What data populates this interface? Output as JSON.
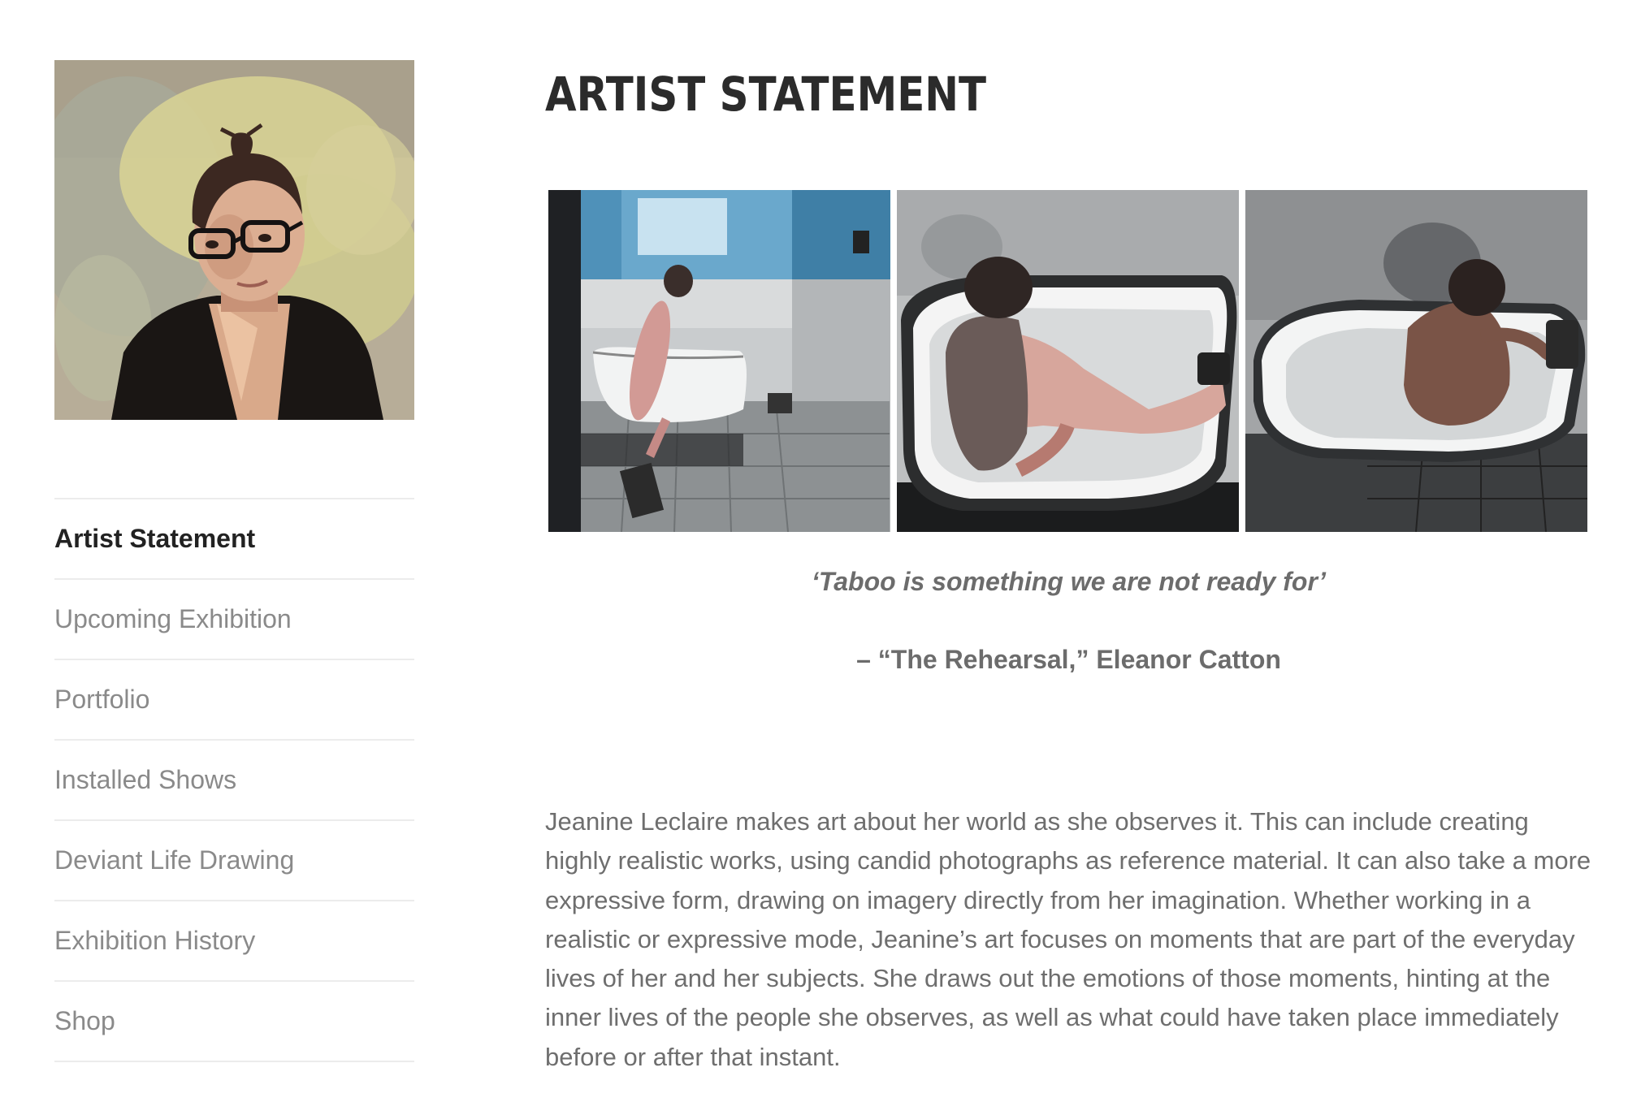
{
  "sidebar": {
    "portrait_alt": "Portrait of the artist",
    "nav": [
      {
        "label": "Artist Statement",
        "active": true
      },
      {
        "label": "Upcoming Exhibition",
        "active": false
      },
      {
        "label": "Portfolio",
        "active": false
      },
      {
        "label": "Installed Shows",
        "active": false
      },
      {
        "label": "Deviant Life Drawing",
        "active": false
      },
      {
        "label": "Exhibition History",
        "active": false
      },
      {
        "label": "Shop",
        "active": false
      }
    ]
  },
  "main": {
    "title": "ARTIST STATEMENT",
    "quote": "‘Taboo is something we are not ready for’",
    "attribution": "– “The Rehearsal,” Eleanor Catton",
    "statement": "Jeanine Leclaire makes art about her world as she observes it. This can include creating highly realistic works, using candid photographs as reference material. It can also take a more expressive form, drawing on imagery directly from her imagination. Whether working in a realistic or expressive mode, Jeanine’s art focuses on moments that are part of the everyday lives of her and her subjects. She draws out the emotions of those moments, hinting at the inner lives of the people she observes, as well as what could have taken place immediately before or after that instant."
  },
  "colors": {
    "title": "#2b2b2b",
    "nav_active": "#222222",
    "nav_inactive": "#8a8a8a",
    "body_text": "#6e6e6e",
    "divider": "#ececec"
  }
}
